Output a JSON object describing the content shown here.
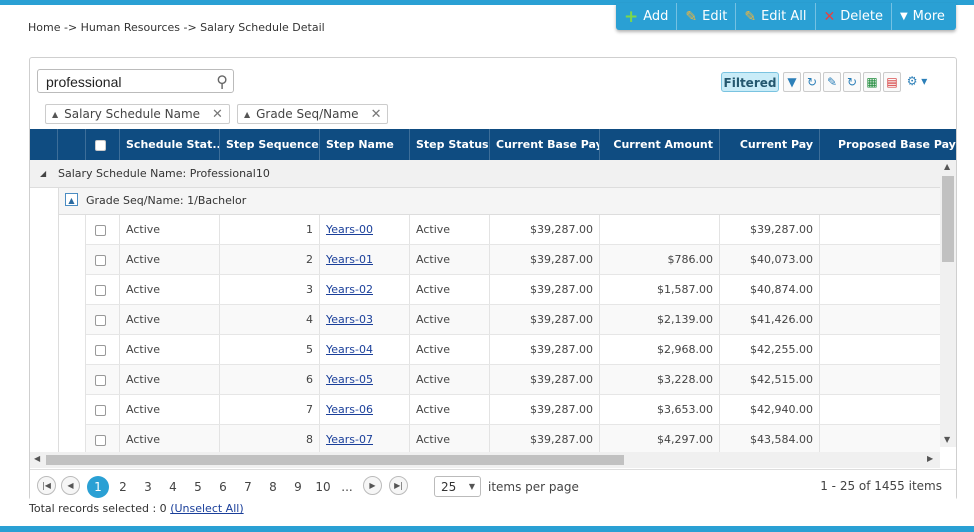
{
  "breadcrumb": "Home -> Human Resources -> Salary Schedule Detail",
  "actions": [
    {
      "label": "Add",
      "icon": "plus-icon"
    },
    {
      "label": "Edit",
      "icon": "pencil-icon"
    },
    {
      "label": "Edit All",
      "icon": "pencil-icon"
    },
    {
      "label": "Delete",
      "icon": "x-icon"
    },
    {
      "label": "More",
      "icon": "chevron-down-icon"
    }
  ],
  "search": {
    "value": "professional",
    "placeholder": ""
  },
  "filter_status": "Filtered",
  "group_chips": [
    "Salary Schedule Name",
    "Grade Seq/Name"
  ],
  "columns": [
    "",
    "Schedule Stat...",
    "Step Sequence",
    "Step Name",
    "Step Status",
    "Current Base Pay",
    "Current Amount",
    "Current Pay",
    "Proposed Base Pay"
  ],
  "group1_label": "Salary Schedule Name: Professional10",
  "group2_label": "Grade Seq/Name: 1/Bachelor",
  "rows": [
    {
      "status": "Active",
      "seq": "1",
      "name": "Years-00",
      "step_status": "Active",
      "base": "$39,287.00",
      "amount": "",
      "pay": "$39,287.00"
    },
    {
      "status": "Active",
      "seq": "2",
      "name": "Years-01",
      "step_status": "Active",
      "base": "$39,287.00",
      "amount": "$786.00",
      "pay": "$40,073.00"
    },
    {
      "status": "Active",
      "seq": "3",
      "name": "Years-02",
      "step_status": "Active",
      "base": "$39,287.00",
      "amount": "$1,587.00",
      "pay": "$40,874.00"
    },
    {
      "status": "Active",
      "seq": "4",
      "name": "Years-03",
      "step_status": "Active",
      "base": "$39,287.00",
      "amount": "$2,139.00",
      "pay": "$41,426.00"
    },
    {
      "status": "Active",
      "seq": "5",
      "name": "Years-04",
      "step_status": "Active",
      "base": "$39,287.00",
      "amount": "$2,968.00",
      "pay": "$42,255.00"
    },
    {
      "status": "Active",
      "seq": "6",
      "name": "Years-05",
      "step_status": "Active",
      "base": "$39,287.00",
      "amount": "$3,228.00",
      "pay": "$42,515.00"
    },
    {
      "status": "Active",
      "seq": "7",
      "name": "Years-06",
      "step_status": "Active",
      "base": "$39,287.00",
      "amount": "$3,653.00",
      "pay": "$42,940.00"
    },
    {
      "status": "Active",
      "seq": "8",
      "name": "Years-07",
      "step_status": "Active",
      "base": "$39,287.00",
      "amount": "$4,297.00",
      "pay": "$43,584.00"
    }
  ],
  "pager": {
    "pages": [
      "1",
      "2",
      "3",
      "4",
      "5",
      "6",
      "7",
      "8",
      "9",
      "10",
      "..."
    ],
    "page_size": "25",
    "per_page_label": "items per page",
    "info": "1 - 25 of 1455 items"
  },
  "footer": {
    "text": "Total records selected : 0",
    "link": "(Unselect All)"
  },
  "colors": {
    "accent": "#2aa0d4",
    "header": "#0f4c81",
    "link": "#1a3f9a"
  }
}
